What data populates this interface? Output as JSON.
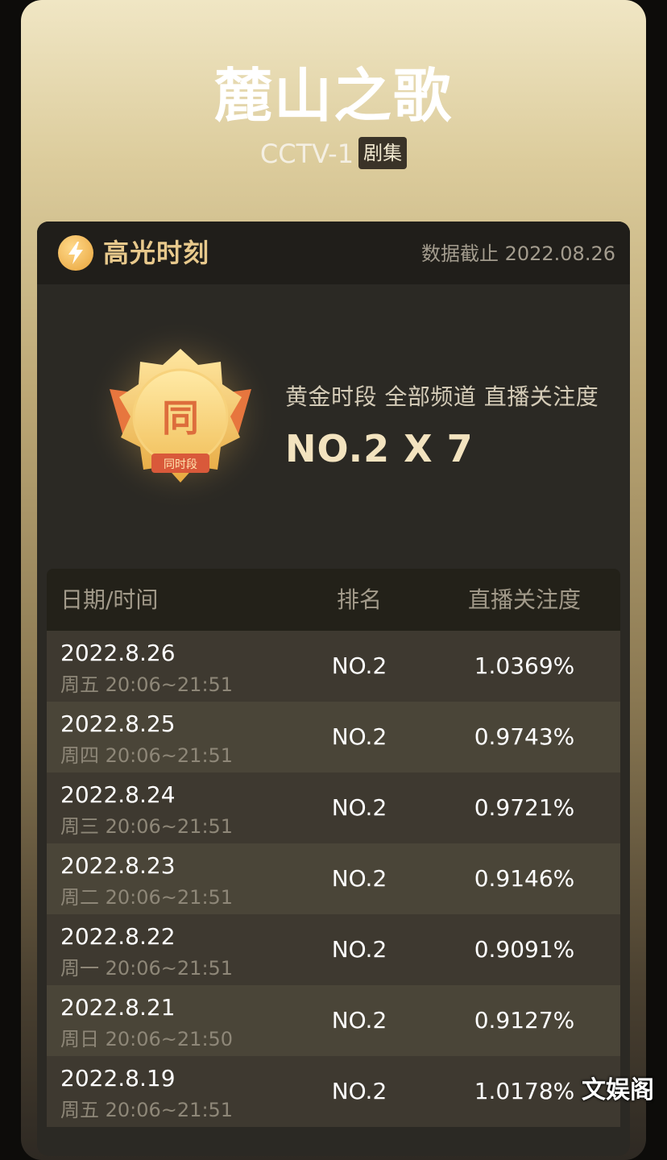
{
  "header": {
    "title": "麓山之歌",
    "channel": "CCTV-1",
    "tag": "剧集"
  },
  "highlight": {
    "section_title": "高光时刻",
    "cutoff_text": "数据截止 2022.08.26",
    "medal_char": "同",
    "medal_ribbon": "同时段",
    "achievement_desc": "黄金时段 全部频道 直播关注度",
    "achievement_value": "NO.2 X 7"
  },
  "table": {
    "headers": [
      "日期/时间",
      "排名",
      "直播关注度"
    ],
    "rows": [
      {
        "date": "2022.8.26",
        "time": "周五 20:06~21:51",
        "rank": "NO.2",
        "attention": "1.0369%"
      },
      {
        "date": "2022.8.25",
        "time": "周四 20:06~21:51",
        "rank": "NO.2",
        "attention": "0.9743%"
      },
      {
        "date": "2022.8.24",
        "time": "周三 20:06~21:51",
        "rank": "NO.2",
        "attention": "0.9721%"
      },
      {
        "date": "2022.8.23",
        "time": "周二 20:06~21:51",
        "rank": "NO.2",
        "attention": "0.9146%"
      },
      {
        "date": "2022.8.22",
        "time": "周一 20:06~21:51",
        "rank": "NO.2",
        "attention": "0.9091%"
      },
      {
        "date": "2022.8.21",
        "time": "周日 20:06~21:50",
        "rank": "NO.2",
        "attention": "0.9127%"
      },
      {
        "date": "2022.8.19",
        "time": "周五 20:06~21:51",
        "rank": "NO.2",
        "attention": "1.0178%"
      }
    ]
  },
  "watermark": "文娱阁",
  "colors": {
    "gold_text": "#e8c98c",
    "panel_bg": "#2b2924",
    "value_text": "#f3e3bf"
  }
}
